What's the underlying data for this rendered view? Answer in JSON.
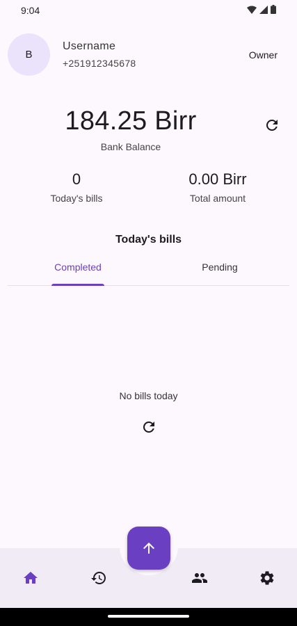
{
  "status_bar": {
    "time": "9:04"
  },
  "header": {
    "avatar_initial": "B",
    "username": "Username",
    "phone": "+251912345678",
    "role": "Owner"
  },
  "balance": {
    "amount": "184.25 Birr",
    "label": "Bank Balance"
  },
  "stats": {
    "bills_count": "0",
    "bills_label": "Today's bills",
    "total_amount": "0.00 Birr",
    "total_label": "Total amount"
  },
  "bills_section": {
    "title": "Today's bills",
    "tabs": [
      {
        "label": "Completed",
        "active": true
      },
      {
        "label": "Pending",
        "active": false
      }
    ],
    "empty_message": "No bills today"
  },
  "bottom_nav": {
    "items": [
      {
        "icon": "home-icon",
        "active": true
      },
      {
        "icon": "history-icon",
        "active": false
      },
      {
        "icon": "people-icon",
        "active": false
      },
      {
        "icon": "gear-icon",
        "active": false
      }
    ],
    "fab_icon": "arrow-up-icon"
  },
  "colors": {
    "accent": "#6a3fc2",
    "background": "#fdf8fd",
    "nav_background": "#f1ebf6",
    "avatar_background": "#ebe3fb"
  }
}
